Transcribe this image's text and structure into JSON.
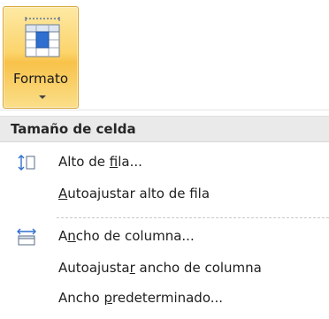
{
  "ribbon": {
    "format_button_label": "Formato"
  },
  "menu": {
    "section_title": "Tamaño de celda",
    "items": [
      {
        "pre": "Alto de ",
        "key": "f",
        "post": "ila..."
      },
      {
        "pre": "",
        "key": "A",
        "post": "utoajustar alto de fila"
      },
      {
        "pre": "A",
        "key": "n",
        "post": "cho de columna..."
      },
      {
        "pre": "Autoajusta",
        "key": "r",
        "post": " ancho de columna"
      },
      {
        "pre": "Ancho ",
        "key": "p",
        "post": "redeterminado..."
      }
    ]
  },
  "icons": {
    "format_icon": "table-format-icon",
    "row_height_icon": "row-height-icon",
    "column_width_icon": "column-width-icon"
  },
  "colors": {
    "accent_gradient_top": "#fde9a4",
    "accent_gradient_mid": "#f8c24a",
    "accent_border": "#d6a53a",
    "icon_blue": "#2f6fd0",
    "header_bg": "#eaeaea"
  }
}
